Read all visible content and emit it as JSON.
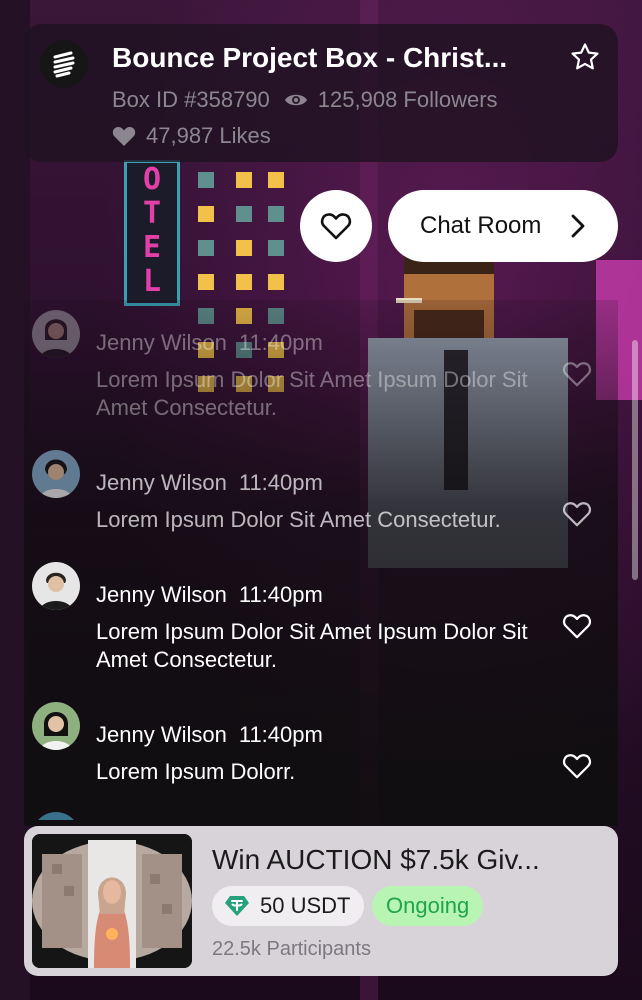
{
  "header": {
    "title": "Bounce Project Box - Christ...",
    "box_id": "Box ID #358790",
    "followers": "125,908 Followers",
    "likes": "47,987 Likes",
    "logo_icon": "bounce-logo-icon",
    "favorite_icon": "star-icon"
  },
  "actions": {
    "like_icon": "heart-icon",
    "chat_label": "Chat Room",
    "chat_icon": "chevron-right-icon"
  },
  "messages": [
    {
      "name": "Jenny Wilson",
      "time": "11:40pm",
      "text": "Lorem Ipsum Dolor Sit Amet Ipsum Dolor Sit Amet Consectetur."
    },
    {
      "name": "Jenny Wilson",
      "time": "11:40pm",
      "text": "Lorem Ipsum Dolor Sit Amet Consectetur."
    },
    {
      "name": "Jenny Wilson",
      "time": "11:40pm",
      "text": "Lorem Ipsum Dolor Sit Amet Ipsum Dolor Sit Amet Consectetur."
    },
    {
      "name": "Jenny Wilson",
      "time": "11:40pm",
      "text": "Lorem Ipsum Dolorr."
    }
  ],
  "auction": {
    "title": "Win AUCTION $7.5k Giv...",
    "price": "50 USDT",
    "status": "Ongoing",
    "participants": "22.5k Participants",
    "currency_icon": "tether-icon"
  },
  "colors": {
    "status_bg": "#b8f5b3",
    "status_text": "#1ea54a",
    "tether": "#26a17b",
    "neon_pink": "#e23fa8"
  }
}
